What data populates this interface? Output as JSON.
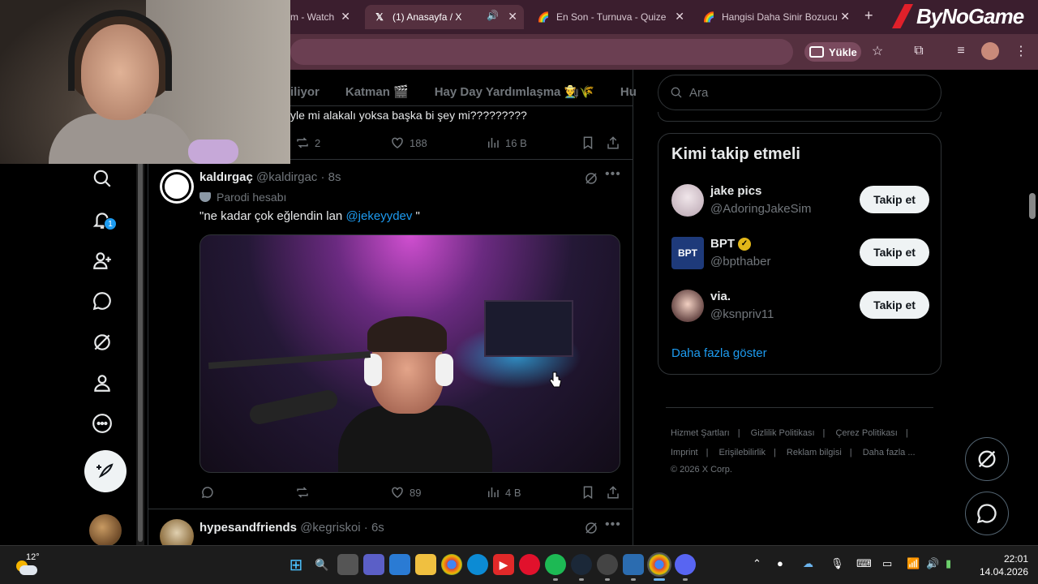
{
  "browser": {
    "tabs": [
      {
        "label": "m - Watch",
        "icon": "youtube-icon",
        "active": false
      },
      {
        "label": "(1) Anasayfa / X",
        "icon": "x-logo-icon",
        "active": true
      },
      {
        "label": "En Son - Turnuva - Quize",
        "icon": "rainbow-icon",
        "active": false
      },
      {
        "label": "Hangisi Daha Sinir Bozucu",
        "icon": "rainbow-icon",
        "active": false
      }
    ],
    "brand_logo": "ByNoGame",
    "upload_label": "Yükle"
  },
  "feed": {
    "topic_tabs": [
      "iliyor",
      "Katman 🎬",
      "Hay Day Yardımlaşma 👨‍🌾🌾",
      "Hu"
    ],
    "prev_post_text": "yle mi alakalı yoksa başka bi şey mi?????????",
    "prev_post_actions": {
      "retweets": "2",
      "likes": "188",
      "views": "16 B"
    },
    "post": {
      "name": "kaldırgaç",
      "handle": "@kaldirgac",
      "time": "· 8s",
      "parody_label": "Parodi hesabı",
      "text_before": "\"ne kadar çok eğlendin lan ",
      "mention": "@jekeyydev",
      "text_after": " \"",
      "likes": "89",
      "views": "4 B"
    },
    "next_post": {
      "name": "hypesandfriends",
      "handle": "@kegriskoi",
      "time": "· 6s"
    }
  },
  "nav": {
    "messages_badge": "1"
  },
  "sidebar": {
    "search_placeholder": "Ara",
    "who_to_follow_title": "Kimi takip etmeli",
    "accounts": [
      {
        "name": "jake pics",
        "handle": "@AdoringJakeSim",
        "verified": false,
        "follow_label": "Takip et"
      },
      {
        "name": "BPT",
        "handle": "@bpthaber",
        "verified": true,
        "follow_label": "Takip et"
      },
      {
        "name": "via.",
        "handle": "@ksnpriv11",
        "verified": false,
        "follow_label": "Takip et"
      }
    ],
    "show_more": "Daha fazla göster",
    "footer_links": [
      "Hizmet Şartları",
      "Gizlilik Politikası",
      "Çerez Politikası",
      "Imprint",
      "Erişilebilirlik",
      "Reklam bilgisi",
      "Daha fazla ..."
    ],
    "copyright": "© 2026 X Corp."
  },
  "taskbar": {
    "temperature": "12°",
    "time": "22:01",
    "date": "14.04.2026"
  },
  "colors": {
    "accent": "#1d9bf0",
    "tab_bar": "#3b1e2e",
    "toolbar": "#55303f",
    "verified_gold": "#e2b719"
  }
}
